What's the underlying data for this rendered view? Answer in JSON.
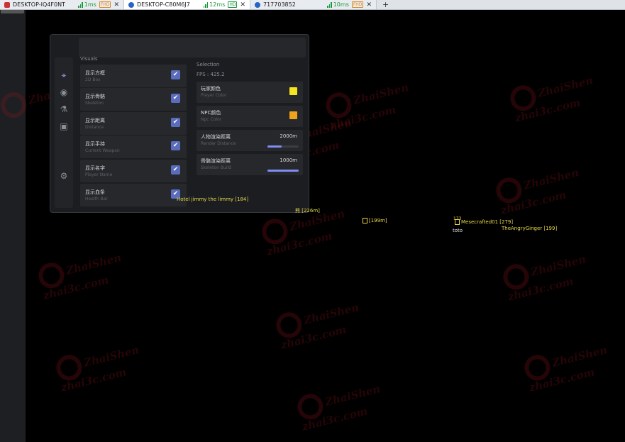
{
  "tabs": [
    {
      "title": "DESKTOP-IQ4F0NT",
      "ping": "1ms",
      "badge": "FHD"
    },
    {
      "title": "DESKTOP-C80M6J7",
      "ping": "12ms",
      "badge": "HD"
    },
    {
      "title": "717703852",
      "ping": "10ms",
      "badge": "FHD"
    }
  ],
  "menu": {
    "visuals_title": "Visuals",
    "visuals": [
      {
        "cn": "显示方框",
        "en": "2D Box",
        "checked": true
      },
      {
        "cn": "显示骨骼",
        "en": "Skeleton",
        "checked": true
      },
      {
        "cn": "显示距离",
        "en": "Distance",
        "checked": true
      },
      {
        "cn": "显示手持",
        "en": "Current Weapon",
        "checked": true
      },
      {
        "cn": "显示名字",
        "en": "Player Name",
        "checked": true
      },
      {
        "cn": "显示血条",
        "en": "Health Bar",
        "checked": true
      }
    ],
    "selection_title": "Selection",
    "fps": "FPS : 425.2",
    "player_color": {
      "cn": "玩家颜色",
      "en": "Player Color",
      "color": "#f4e51c"
    },
    "npc_color": {
      "cn": "NPC颜色",
      "en": "Npc Color",
      "color": "#f0a21a"
    },
    "render_distance": {
      "cn": "人物渲染距离",
      "en": "Render Distance",
      "value": "2000m",
      "fraction": 0.45
    },
    "skeleton_distance": {
      "cn": "骨骼渲染距离",
      "en": "Skeleton Build",
      "value": "1000m",
      "fraction": 1.0
    }
  },
  "esp": {
    "hotel": "Hotel jimmy the limmy [184]",
    "l226": "熊 [226m]",
    "l199": "[199m]",
    "num173": "173",
    "mese": "Mesecrafted01 [279]",
    "toto": "toto",
    "angry": "TheAngryGinger [199]"
  },
  "watermark": {
    "line1": "ZhaiShen",
    "line2": "zhai3c.com"
  }
}
